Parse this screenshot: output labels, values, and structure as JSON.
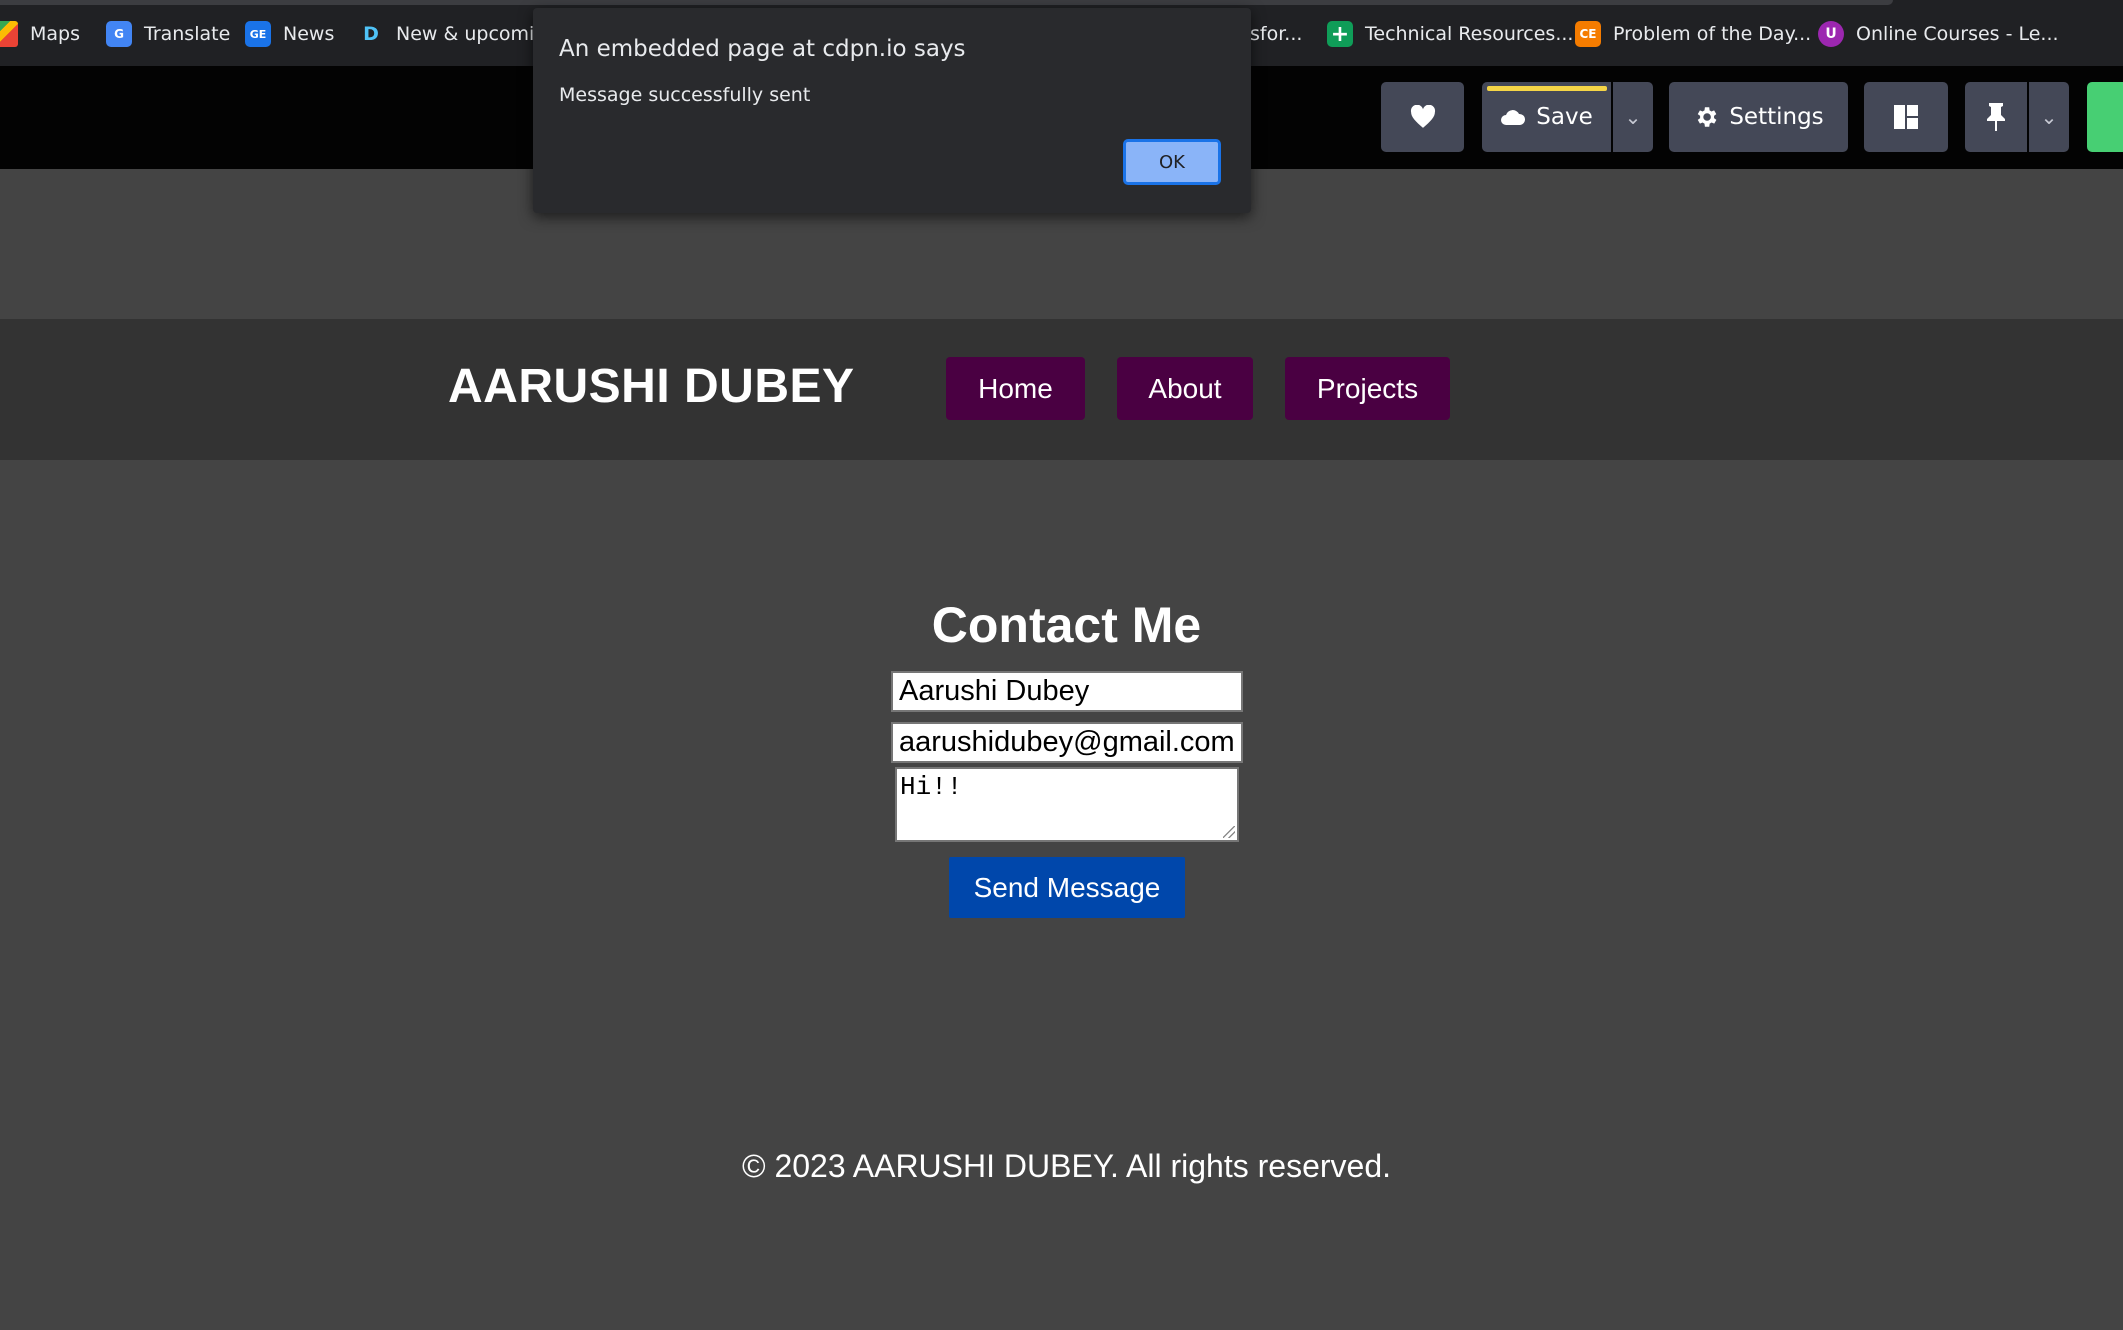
{
  "bookmarks": [
    {
      "label": "Maps",
      "icon": "maps-icon"
    },
    {
      "label": "Translate",
      "icon": "translate-icon"
    },
    {
      "label": "News",
      "icon": "news-icon"
    },
    {
      "label": "New & upcomin",
      "icon": "d-icon"
    },
    {
      "label": "sfor...",
      "icon": ""
    },
    {
      "label": "Technical Resources...",
      "icon": "plus-icon"
    },
    {
      "label": "Problem of the Day...",
      "icon": "problem-icon"
    },
    {
      "label": "Online Courses - Le...",
      "icon": "courses-icon"
    }
  ],
  "toolbar": {
    "save_label": "Save",
    "settings_label": "Settings",
    "colors": {
      "button_bg": "#444857",
      "save_accent": "#f5d547",
      "green": "#47cf73"
    }
  },
  "dialog": {
    "title": "An embedded page at cdpn.io says",
    "message": "Message successfully sent",
    "ok_label": "OK"
  },
  "site": {
    "brand": "AARUSHI DUBEY",
    "nav": [
      "Home",
      "About",
      "Projects"
    ],
    "nav_color": "#4a0042"
  },
  "contact": {
    "title": "Contact Me",
    "name_value": "Aarushi Dubey",
    "email_value": "aarushidubey@gmail.com",
    "message_value": "Hi!!",
    "send_label": "Send Message",
    "send_color": "#0047ab"
  },
  "footer": {
    "text": "© 2023 AARUSHI DUBEY. All rights reserved."
  }
}
